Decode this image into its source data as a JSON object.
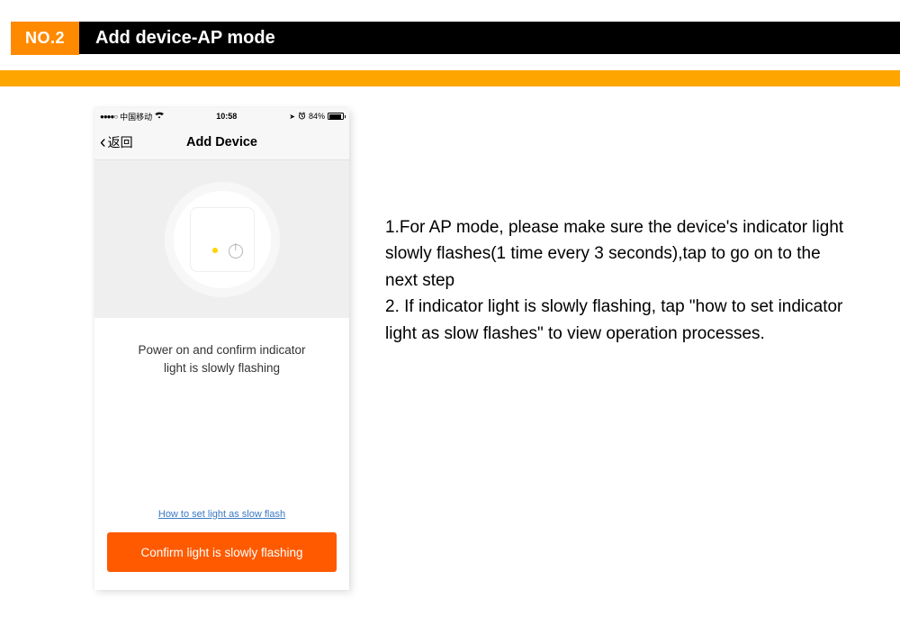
{
  "header": {
    "badge": "NO.2",
    "title": "Add device-AP mode"
  },
  "phone": {
    "status": {
      "signal_dots": "●●●●○",
      "carrier": "中国移动",
      "time": "10:58",
      "location_glyph": "➤",
      "alarm_glyph": "⏰",
      "battery_pct": "84%"
    },
    "nav": {
      "back_chevron": "‹",
      "back_text": "返回",
      "title": "Add Device"
    },
    "prompt_line1": "Power on and confirm indicator",
    "prompt_line2": "light is slowly flashing",
    "howto_link": "How to set light as slow flash",
    "confirm_button": "Confirm light is slowly flashing"
  },
  "instructions": {
    "p1": "1.For AP mode, please make sure the device's indicator light slowly flashes(1 time every 3 seconds),tap to go on to the next step",
    "p2": "2. If indicator light is slowly flashing, tap \"how to set indicator light as slow flashes\" to view operation processes."
  }
}
